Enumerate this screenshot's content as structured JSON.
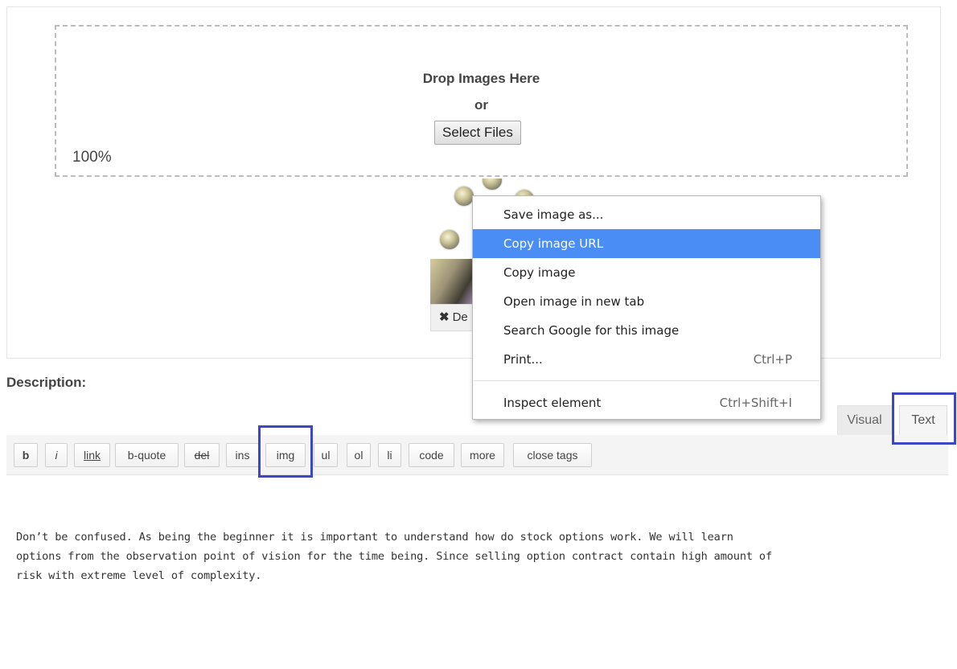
{
  "upload": {
    "drop_title": "Drop Images Here",
    "or_text": "or",
    "select_files": "Select Files",
    "progress": "100%"
  },
  "thumbnail": {
    "delete_label": "De"
  },
  "description": {
    "label": "Description:"
  },
  "tabs": [
    {
      "label": "Visual"
    },
    {
      "label": "Text"
    }
  ],
  "toolbar": {
    "buttons": [
      {
        "label": "b"
      },
      {
        "label": "i"
      },
      {
        "label": "link"
      },
      {
        "label": "b-quote"
      },
      {
        "label": "del"
      },
      {
        "label": "ins"
      },
      {
        "label": "img"
      },
      {
        "label": "ul"
      },
      {
        "label": "ol"
      },
      {
        "label": "li"
      },
      {
        "label": "code"
      },
      {
        "label": "more"
      },
      {
        "label": "close tags"
      }
    ]
  },
  "editor": {
    "content": "Don’t be confused. As being the beginner it is important to understand how do stock options work. We will learn\noptions from the observation point of vision for the time being. Since selling option contract contain high amount of\nrisk with extreme level of complexity."
  },
  "context_menu": {
    "items": [
      {
        "label": "Save image as...",
        "shortcut": ""
      },
      {
        "label": "Copy image URL",
        "shortcut": ""
      },
      {
        "label": "Copy image",
        "shortcut": ""
      },
      {
        "label": "Open image in new tab",
        "shortcut": ""
      },
      {
        "label": "Search Google for this image",
        "shortcut": ""
      },
      {
        "label": "Print...",
        "shortcut": "Ctrl+P"
      },
      {
        "label": "Inspect element",
        "shortcut": "Ctrl+Shift+I"
      }
    ],
    "highlighted_item": "Copy image URL"
  },
  "colors": {
    "menu_highlight": "#4a8ef5",
    "annotation_box": "#3b47c7"
  }
}
